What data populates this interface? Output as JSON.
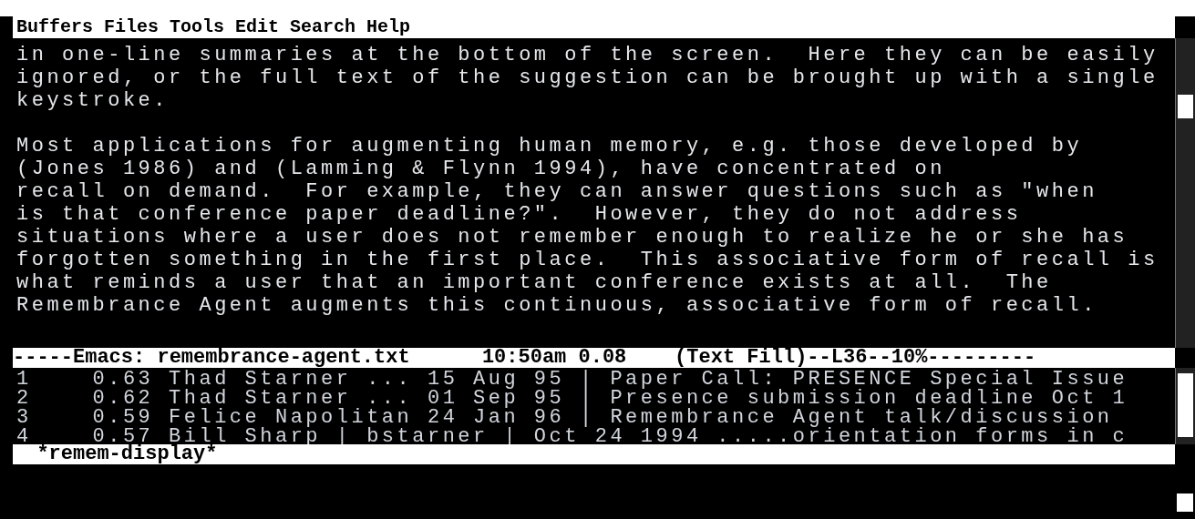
{
  "menu_bar": [
    "Buffers",
    "Files",
    "Tools",
    "Edit",
    "Search",
    "Help"
  ],
  "text_buffer": {
    "paragraphs": [
      [
        "in one-line summaries at the bottom of the screen.  Here they can be easily",
        "ignored, or the full text of the suggestion can be brought up with a single",
        "keystroke."
      ],
      [
        "Most applications for augmenting human memory, e.g. those developed by",
        "(Jones 1986) and (Lamming & Flynn 1994), have concentrated on",
        "recall on demand.  For example, they can answer questions such as \"when",
        "is that conference paper deadline?\".  However, they do not address",
        "situations where a user does not remember enough to realize he or she has",
        "forgotten something in the first place.  This associative form of recall is",
        "what reminds a user that an important conference exists at all.  The",
        "Remembrance Agent augments this continuous, associative form of recall."
      ]
    ]
  },
  "mode_line": "-----Emacs: remembrance-agent.txt      10:50am 0.08    (Text Fill)--L36--10%---------",
  "remem_buffer": {
    "lines": [
      "1    0.63 Thad Starner ... 15 Aug 95 | Paper Call: PRESENCE Special Issue",
      "2    0.62 Thad Starner ... 01 Sep 95 | Presence submission deadline Oct 1",
      "3    0.59 Felice Napolitan 24 Jan 96 | Remembrance Agent talk/discussion",
      "4    0.57 Bill Sharp | bstarner | Oct 24 1994 .....orientation forms in c"
    ]
  },
  "remem_mode_line": "  *remem-display*"
}
